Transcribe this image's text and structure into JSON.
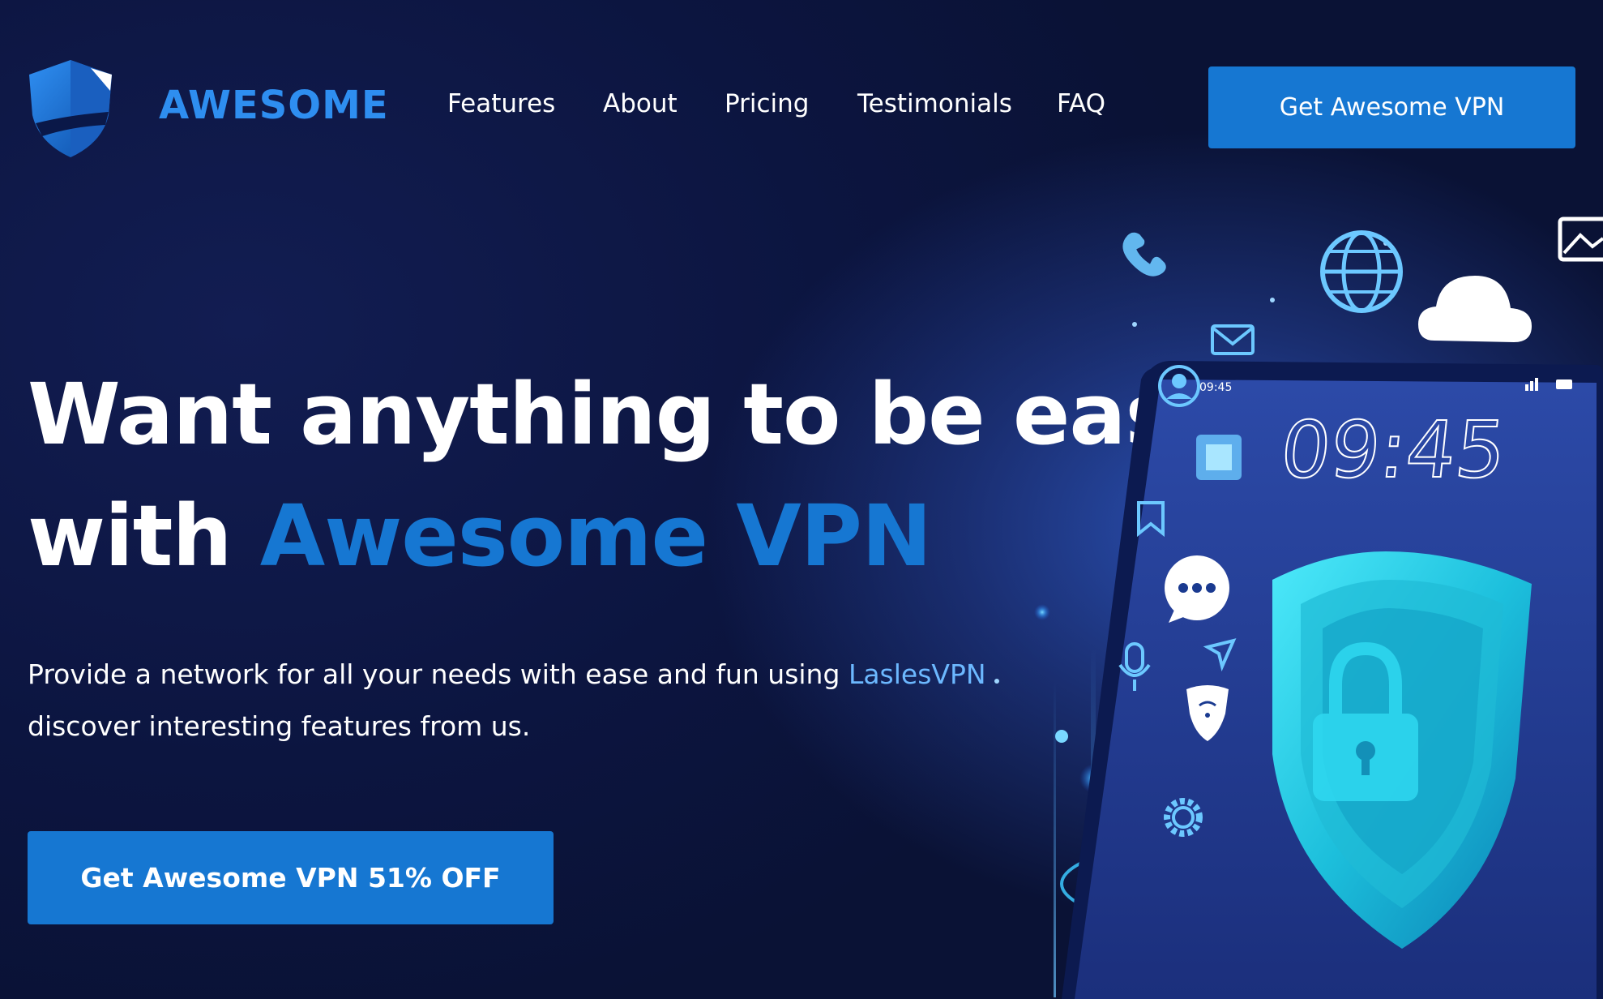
{
  "header": {
    "brand": "AWESOME",
    "nav": [
      "Features",
      "About",
      "Pricing",
      "Testimonials",
      "FAQ"
    ],
    "cta_label": "Get Awesome VPN"
  },
  "hero": {
    "line1": "Want anything to be easy",
    "line2_prefix": "with",
    "line2_accent": "Awesome VPN",
    "subtitle_part1": "Provide a network for all your needs with ease and fun using",
    "subtitle_highlight": "LaslesVPN",
    "subtitle_part2": "discover interesting features from us.",
    "cta_label": "Get Awesome VPN 51% OFF"
  },
  "illustration": {
    "phone_status_time": "09:45",
    "phone_clock": "09:45",
    "icons": [
      "phone-icon",
      "globe-icon",
      "cloud-icon",
      "image-icon",
      "mail-icon",
      "user-icon",
      "chip-icon",
      "bookmark-icon",
      "chat-icon",
      "send-icon",
      "microphone-icon",
      "wifi-shield-icon",
      "gear-icon",
      "shield-lock-icon"
    ]
  },
  "colors": {
    "accent": "#1677d2",
    "brand": "#2e8ef0",
    "highlight": "#6cb8ff",
    "background": "#0c1540"
  }
}
